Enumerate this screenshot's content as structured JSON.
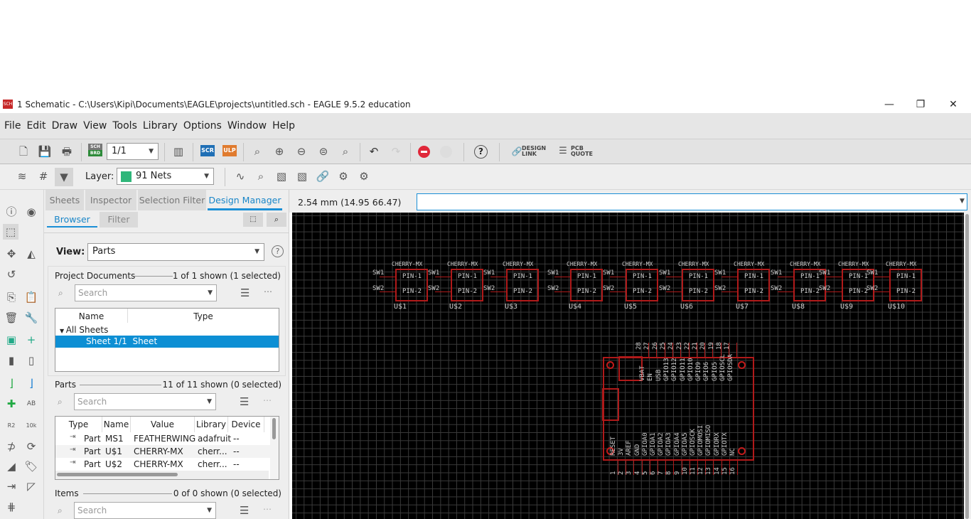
{
  "window": {
    "title": "1 Schematic - C:\\Users\\Kipi\\Documents\\EAGLE\\projects\\untitled.sch - EAGLE 9.5.2 education",
    "icon": "SCH",
    "minimize": "—",
    "restore": "❐",
    "close": "✕"
  },
  "menu": [
    "File",
    "Edit",
    "Draw",
    "View",
    "Tools",
    "Library",
    "Options",
    "Window",
    "Help"
  ],
  "toolbar": {
    "sheet_value": "1/1",
    "scr": "SCR",
    "ulp": "ULP",
    "sch_brd_top": "SCH",
    "sch_brd_bottom": "BRD",
    "design_link": "DESIGN LINK",
    "pcb_quote": "PCB QUOTE",
    "help": "?"
  },
  "toolbar2": {
    "layer_label": "Layer:",
    "layer_value": "91 Nets",
    "layer_color": "#2fb67a"
  },
  "coord": {
    "readout": "2.54 mm (14.95 66.47)",
    "command_value": ""
  },
  "panel": {
    "tabs": [
      "Sheets",
      "Inspector",
      "Selection Filter",
      "Design Manager"
    ],
    "subtabs": [
      "Browser",
      "Filter"
    ],
    "view_label": "View:",
    "view_value": "Parts",
    "project": {
      "title": "Project Documents",
      "count": "1 of 1 shown (1 selected)",
      "search": "Search",
      "cols": [
        "Name",
        "Type"
      ],
      "group": "All Sheets",
      "row": "Sheet 1/1  Sheet"
    },
    "parts": {
      "title": "Parts",
      "count": "11 of 11 shown (0 selected)",
      "search": "Search",
      "cols": [
        "Type",
        "Name",
        "Value",
        "Library",
        "Device"
      ],
      "rows": [
        [
          "Part",
          "MS1",
          "FEATHERWING",
          "adafruit",
          "--"
        ],
        [
          "Part",
          "U$1",
          "CHERRY-MX",
          "cherr...",
          "--"
        ],
        [
          "Part",
          "U$2",
          "CHERRY-MX",
          "cherr...",
          "--"
        ]
      ]
    },
    "items": {
      "title": "Items",
      "count": "0 of 0 shown (0 selected)",
      "search": "Search"
    }
  },
  "schematic": {
    "switch_value": "CHERRY-MX",
    "pin1": "PIN-1",
    "pin2": "PIN-2",
    "sw1": "SW1",
    "sw2": "SW2",
    "switches": [
      "U$1",
      "U$2",
      "U$3",
      "U$4",
      "U$5",
      "U$6",
      "U$7",
      "U$8",
      "U$9",
      "U$10"
    ],
    "feather_top_pins": [
      "28",
      "27",
      "26",
      "25",
      "24",
      "23",
      "22",
      "21",
      "20",
      "19",
      "18",
      "17"
    ],
    "feather_top_labels": [
      "VBAT",
      "EN",
      "USB",
      "GPIO13",
      "GPIO12",
      "GPIO11",
      "GPIO10",
      "GPIO9",
      "GPIO6",
      "GPIO5",
      "GPIOSCL",
      "GPIOSDA"
    ],
    "feather_bottom_pins": [
      "1",
      "2",
      "3",
      "4",
      "5",
      "6",
      "7",
      "8",
      "9",
      "10",
      "11",
      "12",
      "13",
      "14",
      "15",
      "16"
    ],
    "feather_bottom_labels": [
      "RESET",
      "3V",
      "AREF",
      "GND",
      "GPIOA0",
      "GPIOA1",
      "GPIOA2",
      "GPIOA3",
      "GPIOA4",
      "GPIOA5",
      "GPIOSCK",
      "GPIOMOSI",
      "GPIOMISO",
      "GPIORX",
      "GPIOTX",
      "NC"
    ]
  }
}
